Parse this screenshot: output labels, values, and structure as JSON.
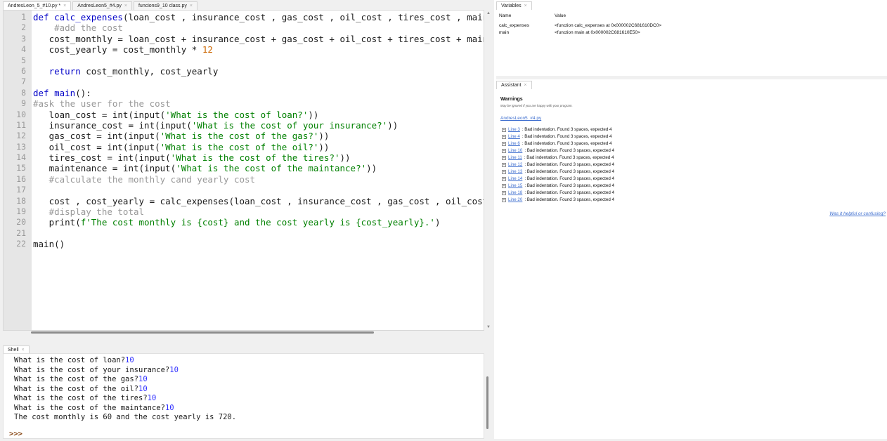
{
  "editor": {
    "tabs": [
      {
        "label": "AndresLeon_5_#10.py *",
        "close": "×"
      },
      {
        "label": "AndresLeon5_#4.py",
        "close": "×"
      },
      {
        "label": "funcions9_10 class.py",
        "close": "×"
      }
    ],
    "line_numbers": [
      "1",
      "2",
      "3",
      "4",
      "5",
      "6",
      "7",
      "8",
      "9",
      "10",
      "11",
      "12",
      "13",
      "14",
      "15",
      "16",
      "17",
      "18",
      "19",
      "20",
      "21",
      "22"
    ],
    "code": {
      "l1_kw": "def ",
      "l1_fn": "calc_expenses",
      "l1_rest": "(loan_cost , insurance_cost , gas_cost , oil_cost , tires_cost , maint",
      "l2": "    #add the cost",
      "l3": "   cost_monthly = loan_cost + insurance_cost + gas_cost + oil_cost + tires_cost + maint",
      "l4_a": "   cost_yearly = cost_monthly * ",
      "l4_num": "12",
      "l6_indent": "   ",
      "l6_kw": "return",
      "l6_rest": " cost_monthly, cost_yearly",
      "l8_kw": "def ",
      "l8_fn": "main",
      "l8_rest": "():",
      "l9": "#ask the user for the cost",
      "l10_a": "   loan_cost = int(input(",
      "l10_s": "'What is the cost of loan?'",
      "l10_b": "))",
      "l11_a": "   insurance_cost = int(input(",
      "l11_s": "'What is the cost of your insurance?'",
      "l11_b": "))",
      "l12_a": "   gas_cost = int(input(",
      "l12_s": "'What is the cost of the gas?'",
      "l12_b": "))",
      "l13_a": "   oil_cost = int(input(",
      "l13_s": "'What is the cost of the oil?'",
      "l13_b": "))",
      "l14_a": "   tires_cost = int(input(",
      "l14_s": "'What is the cost of the tires?'",
      "l14_b": "))",
      "l15_a": "   maintenance = int(input(",
      "l15_s": "'What is the cost of the maintance?'",
      "l15_b": "))",
      "l16": "   #calculate the monthly cand yearly cost",
      "l18": "   cost , cost_yearly = calc_expenses(loan_cost , insurance_cost , gas_cost , oil_cost",
      "l19": "   #display the total",
      "l20_a": "   print(",
      "l20_s": "f'The cost monthly is {cost} and the cost yearly is {cost_yearly}.'",
      "l20_b": ")",
      "l22": "main()"
    }
  },
  "shell": {
    "tab": {
      "label": "Shell",
      "close": "×"
    },
    "lines": [
      {
        "prompt": "What is the cost of loan?",
        "input": "10"
      },
      {
        "prompt": "What is the cost of your insurance?",
        "input": "10"
      },
      {
        "prompt": "What is the cost of the gas?",
        "input": "10"
      },
      {
        "prompt": "What is the cost of the oil?",
        "input": "10"
      },
      {
        "prompt": "What is the cost of the tires?",
        "input": "10"
      },
      {
        "prompt": "What is the cost of the maintance?",
        "input": "10"
      }
    ],
    "output": "The cost monthly is 60 and the cost yearly is 720.",
    "prompt_symbol": ">>>"
  },
  "variables": {
    "tab": {
      "label": "Variables",
      "close": "×"
    },
    "header": {
      "name": "Name",
      "value": "Value"
    },
    "rows": [
      {
        "name": "calc_expenses",
        "value": "<function calc_expenses at 0x000002C681610DC0>"
      },
      {
        "name": "main",
        "value": "<function main at 0x000002C681610E50>"
      }
    ]
  },
  "assistant": {
    "tab": {
      "label": "Assistant",
      "close": "×"
    },
    "warnings_title": "Warnings",
    "warnings_subtitle": "May be ignored if you are happy with your program.",
    "file_link": "AndresLeon5_#4.py",
    "warnings": [
      {
        "line": "Line 3",
        "msg": ": Bad indentation. Found 3 spaces, expected 4"
      },
      {
        "line": "Line 4",
        "msg": ": Bad indentation. Found 3 spaces, expected 4"
      },
      {
        "line": "Line 6",
        "msg": ": Bad indentation. Found 3 spaces, expected 4"
      },
      {
        "line": "Line 10",
        "msg": ": Bad indentation. Found 3 spaces, expected 4"
      },
      {
        "line": "Line 11",
        "msg": ": Bad indentation. Found 3 spaces, expected 4"
      },
      {
        "line": "Line 12",
        "msg": ": Bad indentation. Found 3 spaces, expected 4"
      },
      {
        "line": "Line 13",
        "msg": ": Bad indentation. Found 3 spaces, expected 4"
      },
      {
        "line": "Line 14",
        "msg": ": Bad indentation. Found 3 spaces, expected 4"
      },
      {
        "line": "Line 15",
        "msg": ": Bad indentation. Found 3 spaces, expected 4"
      },
      {
        "line": "Line 18",
        "msg": ": Bad indentation. Found 3 spaces, expected 4"
      },
      {
        "line": "Line 20",
        "msg": ": Bad indentation. Found 3 spaces, expected 4"
      }
    ],
    "expand_symbol": "+",
    "helpful_link": "Was it helpful or confusing?"
  },
  "colors": {
    "keyword": "#0000c8",
    "string": "#008000",
    "comment": "#999999",
    "number": "#cc6600",
    "link": "#3f6fcf"
  }
}
